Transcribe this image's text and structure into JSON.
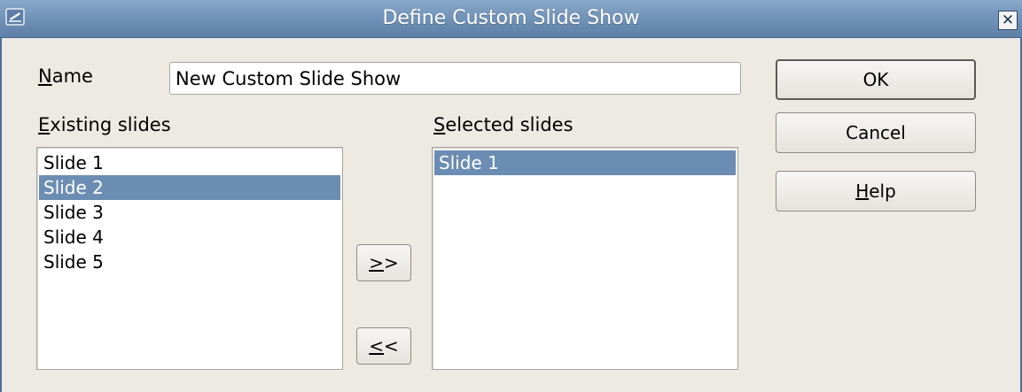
{
  "window": {
    "title": "Define Custom Slide Show",
    "close_glyph": "✕"
  },
  "name_field": {
    "label_mnemonic": "N",
    "label_rest": "ame",
    "value": "New Custom Slide Show"
  },
  "existing": {
    "label_mnemonic": "E",
    "label_rest": "xisting slides",
    "items": [
      "Slide 1",
      "Slide 2",
      "Slide 3",
      "Slide 4",
      "Slide 5"
    ],
    "selected": "Slide 2"
  },
  "selected_slides": {
    "label_mnemonic": "S",
    "label_rest": "elected slides",
    "items": [
      "Slide 1"
    ],
    "selected": "Slide 1"
  },
  "move_buttons": {
    "add_mnemonic": ">",
    "add_rest": ">",
    "remove_mnemonic": "<",
    "remove_rest": "<"
  },
  "buttons": {
    "ok": "OK",
    "cancel": "Cancel",
    "help_mnemonic": "H",
    "help_rest": "elp"
  },
  "colors": {
    "titlebar": "#7394b9",
    "selection": "#6c8db3",
    "dialog_bg": "#ede9e3"
  },
  "icons": {
    "window_icon": "app-window-icon",
    "close": "close-icon"
  }
}
